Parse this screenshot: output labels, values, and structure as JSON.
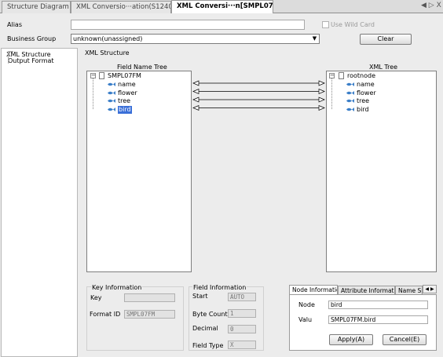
{
  "tabs": [
    {
      "label": "Structure Diagram"
    },
    {
      "label": "XML Conversio···ation(S12404)"
    },
    {
      "label": "XML Conversi···n[SMPL07FM]"
    }
  ],
  "window_controls": {
    "text": "◀ ▷ X"
  },
  "form": {
    "alias_label": "Alias",
    "alias_value": "",
    "use_wildcard_label": "Use Wild Card",
    "business_group_label": "Business Group",
    "business_group_value": "unknown(unassigned)",
    "clear_label": "Clear"
  },
  "nav": {
    "items": [
      {
        "label": "XML Structure"
      },
      {
        "label": "Output Format"
      }
    ]
  },
  "xml_structure": {
    "section_label": "XML Structure",
    "field_tree_label": "Field Name Tree",
    "xml_tree_label": "XML Tree",
    "field_root": "SMPL07FM",
    "field_children": [
      "name",
      "flower",
      "tree",
      "bird"
    ],
    "selected_field": "bird",
    "xml_root": "rootnode",
    "xml_children": [
      "name",
      "flower",
      "tree",
      "bird"
    ]
  },
  "key_info": {
    "title": "Key Information",
    "key_label": "Key",
    "key_value": "",
    "format_id_label": "Format ID",
    "format_id_value": "SMPL07FM"
  },
  "field_info": {
    "title": "Field Information",
    "start_label": "Start",
    "start_value": "AUTO",
    "byte_count_label": "Byte Count",
    "byte_count_value": "1",
    "decimal_label": "Decimal",
    "decimal_value": "0",
    "field_type_label": "Field Type",
    "field_type_value": "X"
  },
  "node_info": {
    "tabs": [
      "Node Information",
      "Attribute Information",
      "Name Spa"
    ],
    "scroll_arrows": "◀ ▶",
    "node_label": "Node",
    "node_value": "bird",
    "value_label": "Valu",
    "value_value": "SMPL07FM.bird",
    "apply_label": "Apply(A)",
    "cancel_label": "Cancel(E)"
  },
  "colors": {
    "selection": "#3a6fd8",
    "fish_icon": "#3a7ec8"
  }
}
